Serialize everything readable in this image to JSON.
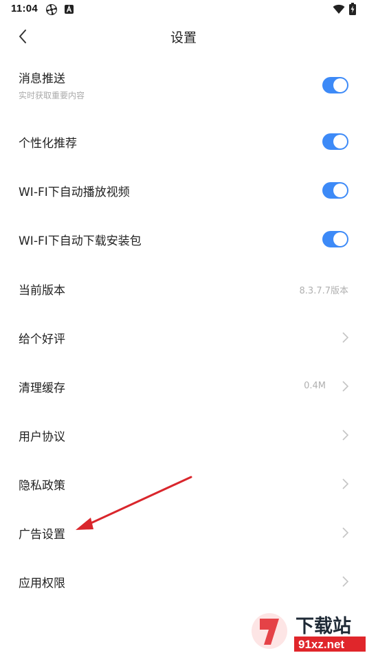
{
  "status_bar": {
    "time": "11:04",
    "icons": [
      "pinwheel-icon",
      "font-a-icon",
      "wifi-icon",
      "battery-charging-icon"
    ]
  },
  "header": {
    "title": "设置",
    "back_icon": "chevron-left-icon"
  },
  "settings": {
    "push": {
      "label": "消息推送",
      "sub": "实时获取重要内容",
      "enabled": true
    },
    "personalized": {
      "label": "个性化推荐",
      "enabled": true
    },
    "wifi_autoplay": {
      "label": "WI-FI下自动播放视频",
      "enabled": true
    },
    "wifi_download": {
      "label": "WI-FI下自动下载安装包",
      "enabled": true
    },
    "version": {
      "label": "当前版本",
      "value": "8.3.7.7版本"
    },
    "rate": {
      "label": "给个好评"
    },
    "clear_cache": {
      "label": "清理缓存",
      "value": "0.4M"
    },
    "user_agreement": {
      "label": "用户协议"
    },
    "privacy": {
      "label": "隐私政策"
    },
    "ad_settings": {
      "label": "广告设置"
    },
    "permissions": {
      "label": "应用权限"
    }
  },
  "colors": {
    "toggle_on": "#3d8af7",
    "annotation_arrow": "#d9262c",
    "watermark_red": "#e0262b",
    "watermark_dark": "#1f2a36"
  },
  "watermark": {
    "brand": "下载站",
    "domain": "91xz.net"
  }
}
